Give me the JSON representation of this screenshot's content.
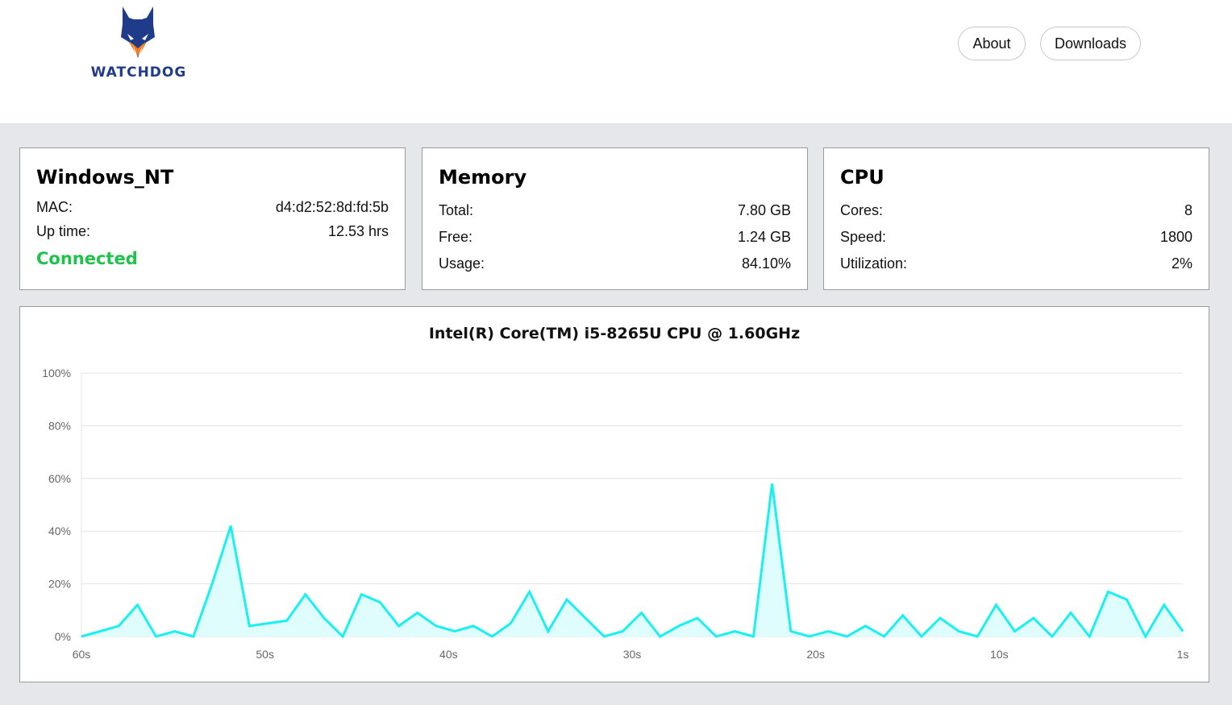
{
  "brand": {
    "name": "WATCHDOG"
  },
  "nav": {
    "about": "About",
    "downloads": "Downloads"
  },
  "system": {
    "title": "Windows_NT",
    "mac_label": "MAC:",
    "mac_value": "d4:d2:52:8d:fd:5b",
    "uptime_label": "Up time:",
    "uptime_value": "12.53 hrs",
    "status": "Connected",
    "status_color": "#1ec34a"
  },
  "memory": {
    "title": "Memory",
    "total_label": "Total:",
    "total_value": "7.80 GB",
    "free_label": "Free:",
    "free_value": "1.24 GB",
    "usage_label": "Usage:",
    "usage_value": "84.10%"
  },
  "cpu": {
    "title": "CPU",
    "cores_label": "Cores:",
    "cores_value": "8",
    "speed_label": "Speed:",
    "speed_value": "1800",
    "util_label": "Utilization:",
    "util_value": "2%"
  },
  "colors": {
    "series": "#19f0f0",
    "fill": "#e0fdfd",
    "brand": "#1f3b8a",
    "accent": "#f47b20"
  },
  "chart_data": {
    "type": "area",
    "title": "Intel(R) Core(TM) i5-8265U CPU @ 1.60GHz",
    "ylim": [
      0,
      100
    ],
    "yticks": [
      "0%",
      "20%",
      "40%",
      "60%",
      "80%",
      "100%"
    ],
    "xticks": [
      "60s",
      "50s",
      "40s",
      "30s",
      "20s",
      "10s",
      "1s"
    ],
    "xlabel": "",
    "ylabel": "",
    "grid": true,
    "legend": "none",
    "series": [
      {
        "values": [
          0,
          2,
          4,
          12,
          0,
          2,
          0,
          20,
          42,
          4,
          5,
          6,
          16,
          7,
          0,
          16,
          13,
          4,
          9,
          4,
          2,
          4,
          0,
          5,
          17,
          2,
          14,
          7,
          0,
          2,
          9,
          0,
          4,
          7,
          0,
          2,
          0,
          58,
          2,
          0,
          2,
          0,
          4,
          0,
          8,
          0,
          7,
          2,
          0,
          12,
          2,
          7,
          0,
          9,
          0,
          17,
          14,
          0,
          12,
          2
        ]
      }
    ]
  }
}
